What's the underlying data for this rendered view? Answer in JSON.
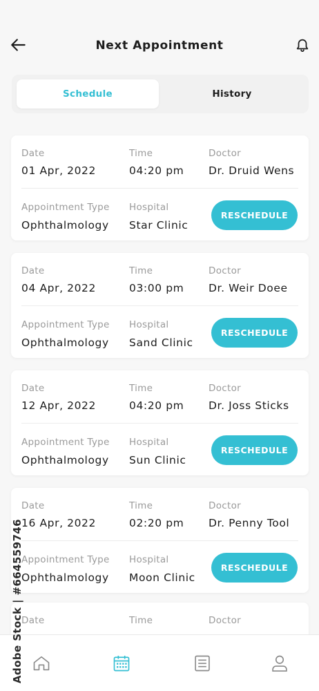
{
  "header": {
    "title": "Next Appointment"
  },
  "tabs": [
    {
      "label": "Schedule",
      "active": true
    },
    {
      "label": "History",
      "active": false
    }
  ],
  "labels": {
    "date": "Date",
    "time": "Time",
    "doctor": "Doctor",
    "type": "Appointment Type",
    "hospital": "Hospital",
    "action": "RESCHEDULE"
  },
  "appointments": [
    {
      "date": "01 Apr, 2022",
      "time": "04:20 pm",
      "doctor": "Dr. Druid Wens",
      "type": "Ophthalmology",
      "hospital": "Star Clinic"
    },
    {
      "date": "04 Apr, 2022",
      "time": "03:00 pm",
      "doctor": "Dr. Weir Doee",
      "type": "Ophthalmology",
      "hospital": "Sand Clinic"
    },
    {
      "date": "12 Apr, 2022",
      "time": "04:20 pm",
      "doctor": "Dr. Joss Sticks",
      "type": "Ophthalmology",
      "hospital": "Sun Clinic"
    },
    {
      "date": "16 Apr, 2022",
      "time": "02:20 pm",
      "doctor": "Dr. Penny Tool",
      "type": "Ophthalmology",
      "hospital": "Moon Clinic"
    }
  ],
  "watermark": "Adobe Stock | #664559746",
  "colors": {
    "accent": "#34bfd3",
    "background": "#f7f7f7",
    "card": "#ffffff"
  },
  "icons": {
    "back": "arrow-left-icon",
    "bell": "bell-icon",
    "nav": [
      "home-icon",
      "calendar-icon",
      "list-icon",
      "profile-icon"
    ]
  }
}
